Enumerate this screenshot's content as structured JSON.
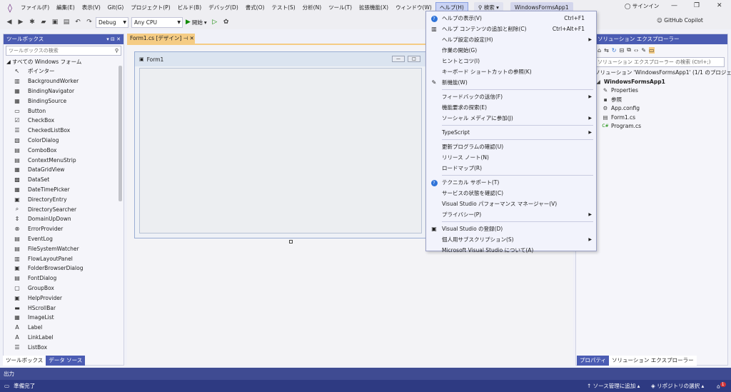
{
  "menubar": {
    "items": [
      "ファイル(F)",
      "編集(E)",
      "表示(V)",
      "Git(G)",
      "プロジェクト(P)",
      "ビルド(B)",
      "デバッグ(D)",
      "書式(O)",
      "テスト(S)",
      "分析(N)",
      "ツール(T)",
      "拡張機能(X)",
      "ウィンドウ(W)",
      "ヘルプ(H)"
    ],
    "search_label": "検索",
    "solution_name": "WindowsFormsApp1",
    "signin": "サインイン"
  },
  "toolbar": {
    "config": "Debug",
    "platform": "Any CPU",
    "start": "開始",
    "copilot": "GitHub Copilot"
  },
  "toolbox": {
    "title": "ツールボックス",
    "search_placeholder": "ツールボックスの検索",
    "group": "すべての Windows フォーム",
    "items": [
      {
        "label": "ポインター",
        "icon": "pointer-icon"
      },
      {
        "label": "BackgroundWorker",
        "icon": "background-worker-icon"
      },
      {
        "label": "BindingNavigator",
        "icon": "binding-navigator-icon"
      },
      {
        "label": "BindingSource",
        "icon": "binding-source-icon"
      },
      {
        "label": "Button",
        "icon": "button-icon"
      },
      {
        "label": "CheckBox",
        "icon": "checkbox-icon"
      },
      {
        "label": "CheckedListBox",
        "icon": "checked-listbox-icon"
      },
      {
        "label": "ColorDialog",
        "icon": "color-dialog-icon"
      },
      {
        "label": "ComboBox",
        "icon": "combobox-icon"
      },
      {
        "label": "ContextMenuStrip",
        "icon": "context-menu-icon"
      },
      {
        "label": "DataGridView",
        "icon": "datagrid-icon"
      },
      {
        "label": "DataSet",
        "icon": "dataset-icon"
      },
      {
        "label": "DateTimePicker",
        "icon": "datetime-icon"
      },
      {
        "label": "DirectoryEntry",
        "icon": "directory-entry-icon"
      },
      {
        "label": "DirectorySearcher",
        "icon": "directory-searcher-icon"
      },
      {
        "label": "DomainUpDown",
        "icon": "domain-updown-icon"
      },
      {
        "label": "ErrorProvider",
        "icon": "error-provider-icon"
      },
      {
        "label": "EventLog",
        "icon": "eventlog-icon"
      },
      {
        "label": "FileSystemWatcher",
        "icon": "filesystem-watcher-icon"
      },
      {
        "label": "FlowLayoutPanel",
        "icon": "flow-layout-icon"
      },
      {
        "label": "FolderBrowserDialog",
        "icon": "folder-browser-icon"
      },
      {
        "label": "FontDialog",
        "icon": "font-dialog-icon"
      },
      {
        "label": "GroupBox",
        "icon": "groupbox-icon"
      },
      {
        "label": "HelpProvider",
        "icon": "help-provider-icon"
      },
      {
        "label": "HScrollBar",
        "icon": "hscrollbar-icon"
      },
      {
        "label": "ImageList",
        "icon": "imagelist-icon"
      },
      {
        "label": "Label",
        "icon": "label-icon"
      },
      {
        "label": "LinkLabel",
        "icon": "linklabel-icon"
      },
      {
        "label": "ListBox",
        "icon": "listbox-icon"
      }
    ],
    "tabs": [
      "ツールボックス",
      "データ ソース"
    ]
  },
  "designer": {
    "tab_label": "Form1.cs [デザイン]",
    "form_title": "Form1"
  },
  "solution_explorer": {
    "title": "ソリューション エクスプローラー",
    "search_placeholder": "ソリューション エクスプローラー の検索 (Ctrl+;)",
    "solution_line": "ソリューション 'WindowsFormsApp1' (1/1 のプロジェクト)",
    "project": "WindowsFormsApp1",
    "nodes": [
      "Properties",
      "参照",
      "App.config",
      "Form1.cs",
      "Program.cs"
    ],
    "tabs": [
      "プロパティ",
      "ソリューション エクスプローラー"
    ]
  },
  "output": {
    "label": "出力"
  },
  "status": {
    "ready": "準備完了",
    "source_control": "ソース管理に追加",
    "repo_select": "リポジトリの選択",
    "notifications": "1"
  },
  "help_menu": {
    "sections": [
      [
        {
          "label": "ヘルプの表示(V)",
          "shortcut": "Ctrl+F1",
          "icon": "help-icon"
        },
        {
          "label": "ヘルプ コンテンツの追加と削除(C)",
          "shortcut": "Ctrl+Alt+F1",
          "icon": "library-icon"
        },
        {
          "label": "ヘルプ設定の設定(H)",
          "submenu": true
        },
        {
          "label": "作業の開始(G)"
        },
        {
          "label": "ヒントとコツ(I)"
        },
        {
          "label": "キーボード ショートカットの参照(K)"
        },
        {
          "label": "新機能(W)",
          "icon": "new-feature-icon"
        }
      ],
      [
        {
          "label": "フィードバックの送信(F)",
          "submenu": true
        },
        {
          "label": "機能要求の探索(E)"
        },
        {
          "label": "ソーシャル メディアに参加(J)",
          "submenu": true
        }
      ],
      [
        {
          "label": "TypeScript",
          "submenu": true
        }
      ],
      [
        {
          "label": "更新プログラムの確認(U)"
        },
        {
          "label": "リリース ノート(N)"
        },
        {
          "label": "ロードマップ(R)"
        }
      ],
      [
        {
          "label": "テクニカル サポート(T)",
          "icon": "support-icon"
        },
        {
          "label": "サービスの状態を確認(C)"
        },
        {
          "label": "Visual Studio パフォーマンス マネージャー(V)"
        },
        {
          "label": "プライバシー(P)",
          "submenu": true
        }
      ],
      [
        {
          "label": "Visual Studio の登録(D)",
          "icon": "register-icon"
        },
        {
          "label": "個人用サブスクリプション(S)",
          "submenu": true
        },
        {
          "label": "Microsoft Visual Studio について(A)"
        }
      ]
    ]
  }
}
